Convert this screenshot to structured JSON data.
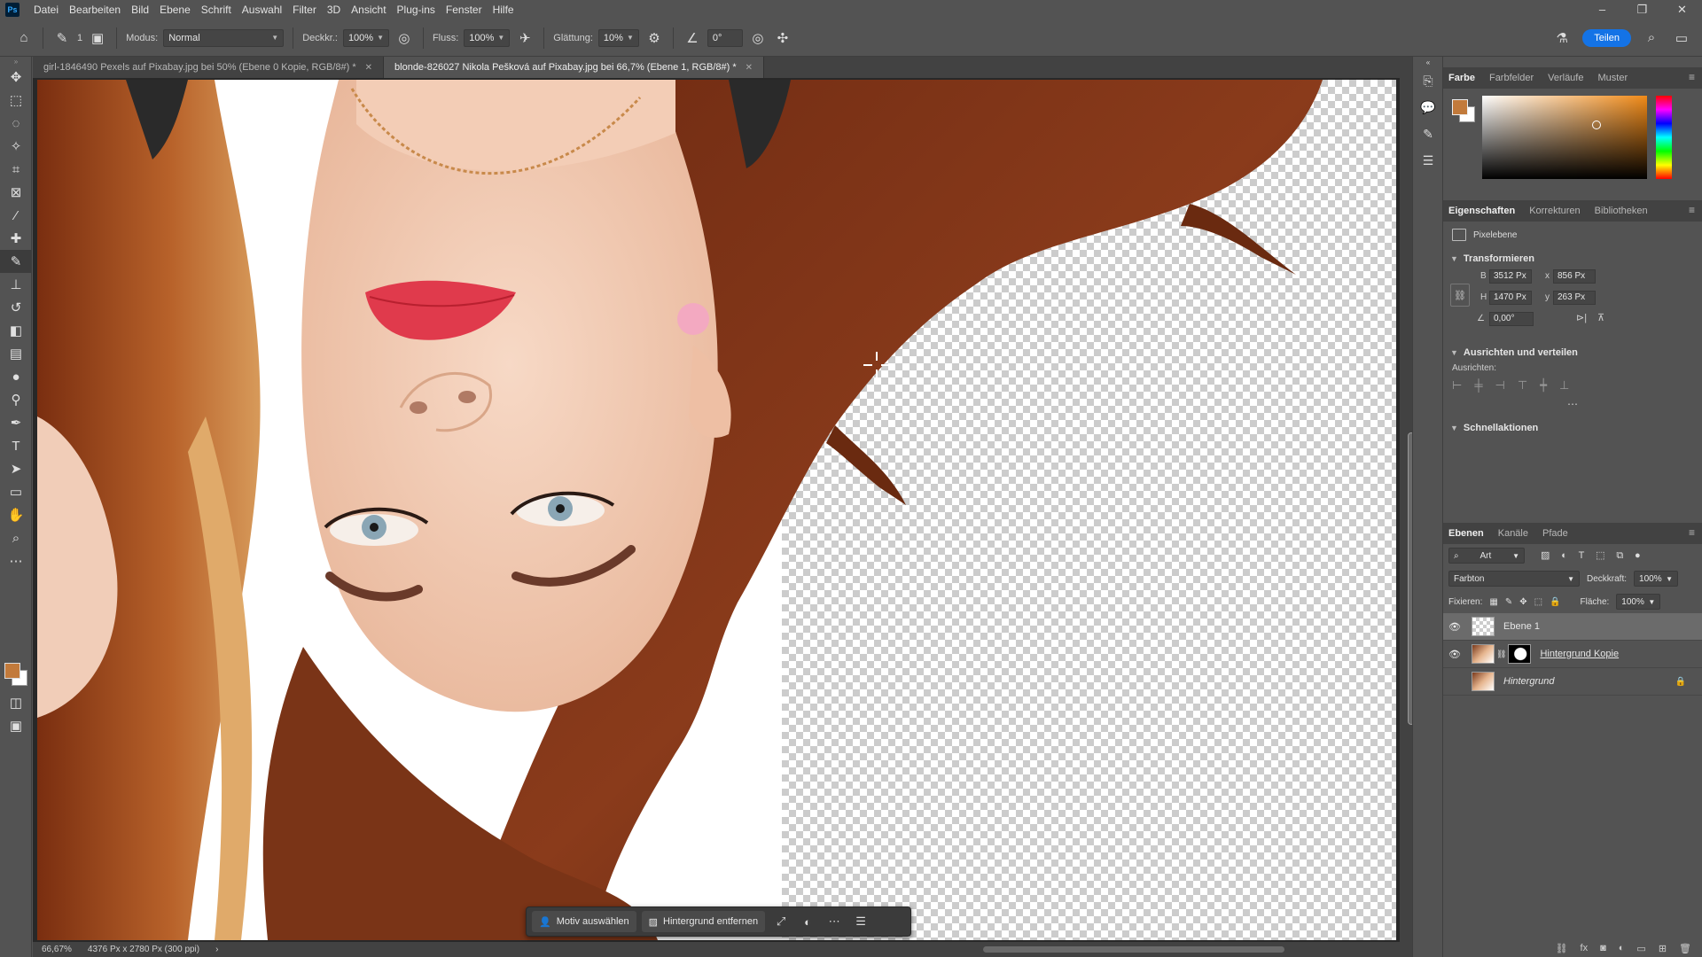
{
  "menu": {
    "logo": "Ps",
    "items": [
      "Datei",
      "Bearbeiten",
      "Bild",
      "Ebene",
      "Schrift",
      "Auswahl",
      "Filter",
      "3D",
      "Ansicht",
      "Plug-ins",
      "Fenster",
      "Hilfe"
    ]
  },
  "options": {
    "brush_size": "1",
    "mode_label": "Modus:",
    "mode_value": "Normal",
    "opacity_label": "Deckkr.:",
    "opacity_value": "100%",
    "flow_label": "Fluss:",
    "flow_value": "100%",
    "smoothing_label": "Glättung:",
    "smoothing_value": "10%",
    "angle_value": "0°",
    "share_label": "Teilen"
  },
  "tabs": [
    {
      "label": "girl-1846490 Pexels auf Pixabay.jpg bei 50% (Ebene 0 Kopie, RGB/8#) *"
    },
    {
      "label": "blonde-826027 Nikola Pešková auf Pixabay.jpg bei 66,7% (Ebene 1, RGB/8#) *"
    }
  ],
  "context_bar": {
    "select_subject": "Motiv auswählen",
    "remove_bg": "Hintergrund entfernen"
  },
  "status": {
    "zoom": "66,67%",
    "doc_size": "4376 Px x 2780 Px (300 ppi)"
  },
  "color_panel": {
    "tabs": [
      "Farbe",
      "Farbfelder",
      "Verläufe",
      "Muster"
    ],
    "fg_color": "#c27a3b",
    "bg_color": "#ffffff"
  },
  "properties": {
    "tabs": [
      "Eigenschaften",
      "Korrekturen",
      "Bibliotheken"
    ],
    "layer_type": "Pixelebene",
    "transform_title": "Transformieren",
    "w_label": "B",
    "w_value": "3512 Px",
    "h_label": "H",
    "h_value": "1470 Px",
    "x_label": "x",
    "x_value": "856 Px",
    "y_label": "y",
    "y_value": "263 Px",
    "angle_value": "0,00°",
    "align_title": "Ausrichten und verteilen",
    "align_label": "Ausrichten:",
    "quick_title": "Schnellaktionen"
  },
  "layers": {
    "tabs": [
      "Ebenen",
      "Kanäle",
      "Pfade"
    ],
    "filter_placeholder": "Art",
    "blend_mode": "Farbton",
    "opacity_label": "Deckkraft:",
    "opacity_value": "100%",
    "lock_label": "Fixieren:",
    "fill_label": "Fläche:",
    "fill_value": "100%",
    "items": [
      {
        "name": "Ebene 1",
        "visible": true
      },
      {
        "name": "Hintergrund Kopie",
        "visible": true
      },
      {
        "name": "Hintergrund",
        "visible": false
      }
    ]
  }
}
